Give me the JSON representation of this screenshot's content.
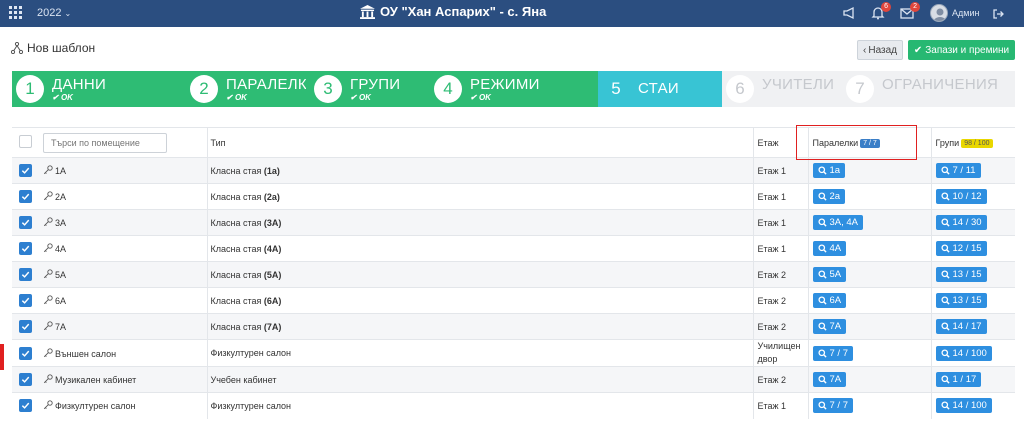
{
  "topbar": {
    "year": "2022",
    "school_name": "ОУ \"Хан Аспарих\" - с. Яна",
    "notifications_count": "6",
    "messages_count": "2",
    "user_name": "Админ"
  },
  "page": {
    "title": "Нов шаблон",
    "back_label": "Назад",
    "save_label": "Запази и премини"
  },
  "wizard": {
    "steps": [
      {
        "num": "1",
        "label": "ДАННИ",
        "status": "OK"
      },
      {
        "num": "2",
        "label": "ПАРАЛЕЛКИ",
        "status": "OK"
      },
      {
        "num": "3",
        "label": "ГРУПИ",
        "status": "OK"
      },
      {
        "num": "4",
        "label": "РЕЖИМИ",
        "status": "OK"
      },
      {
        "num": "5",
        "label": "СТАИ",
        "status": ""
      },
      {
        "num": "6",
        "label": "УЧИТЕЛИ",
        "status": ""
      },
      {
        "num": "7",
        "label": "ОГРАНИЧЕНИЯ",
        "status": ""
      }
    ]
  },
  "table": {
    "search_placeholder": "Търси по помещение",
    "headers": {
      "type": "Тип",
      "floor": "Етаж",
      "classes": "Паралелки",
      "classes_count": "7 / 7",
      "groups": "Групи",
      "groups_count": "98 / 100"
    },
    "rows": [
      {
        "name": "1А",
        "type": "Класна стая",
        "type_bold": "(1а)",
        "floor": "Етаж 1",
        "classes": "1а",
        "groups": "7 / 11"
      },
      {
        "name": "2А",
        "type": "Класна стая",
        "type_bold": "(2а)",
        "floor": "Етаж 1",
        "classes": "2а",
        "groups": "10 / 12"
      },
      {
        "name": "3А",
        "type": "Класна стая",
        "type_bold": "(3А)",
        "floor": "Етаж 1",
        "classes": "3А, 4А",
        "groups": "14 / 30"
      },
      {
        "name": "4А",
        "type": "Класна стая",
        "type_bold": "(4А)",
        "floor": "Етаж 1",
        "classes": "4А",
        "groups": "12 / 15"
      },
      {
        "name": "5А",
        "type": "Класна стая",
        "type_bold": "(5А)",
        "floor": "Етаж 2",
        "classes": "5А",
        "groups": "13 / 15"
      },
      {
        "name": "6А",
        "type": "Класна стая",
        "type_bold": "(6А)",
        "floor": "Етаж 2",
        "classes": "6А",
        "groups": "13 / 15"
      },
      {
        "name": "7А",
        "type": "Класна стая",
        "type_bold": "(7А)",
        "floor": "Етаж 2",
        "classes": "7А",
        "groups": "14 / 17"
      },
      {
        "name": "Външен салон",
        "type": "Физкултурен салон",
        "type_bold": "",
        "floor": "Училищен двор",
        "classes": "7 / 7",
        "groups": "14 / 100"
      },
      {
        "name": "Музикален кабинет",
        "type": "Учебен кабинет",
        "type_bold": "",
        "floor": "Етаж 2",
        "classes": "7А",
        "groups": "1 / 17"
      },
      {
        "name": "Физкултурен салон",
        "type": "Физкултурен салон",
        "type_bold": "",
        "floor": "Етаж 1",
        "classes": "7 / 7",
        "groups": "14 / 100"
      }
    ]
  }
}
